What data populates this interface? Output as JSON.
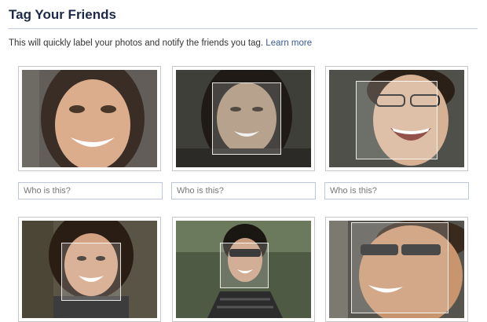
{
  "header": {
    "title": "Tag Your Friends"
  },
  "intro": {
    "text": "This will quickly label your photos and notify the friends you tag.",
    "link": "Learn more"
  },
  "photos": [
    {
      "placeholder": "Who is this?",
      "icon": "face-photo-1"
    },
    {
      "placeholder": "Who is this?",
      "icon": "face-photo-2"
    },
    {
      "placeholder": "Who is this?",
      "icon": "face-photo-3"
    },
    {
      "icon": "face-photo-4"
    },
    {
      "icon": "face-photo-5"
    },
    {
      "icon": "face-photo-6"
    }
  ],
  "colors": {
    "title": "#1c2a47",
    "link": "#3b5998",
    "divider": "#c4cde0",
    "input_border": "#bdc7d8"
  }
}
